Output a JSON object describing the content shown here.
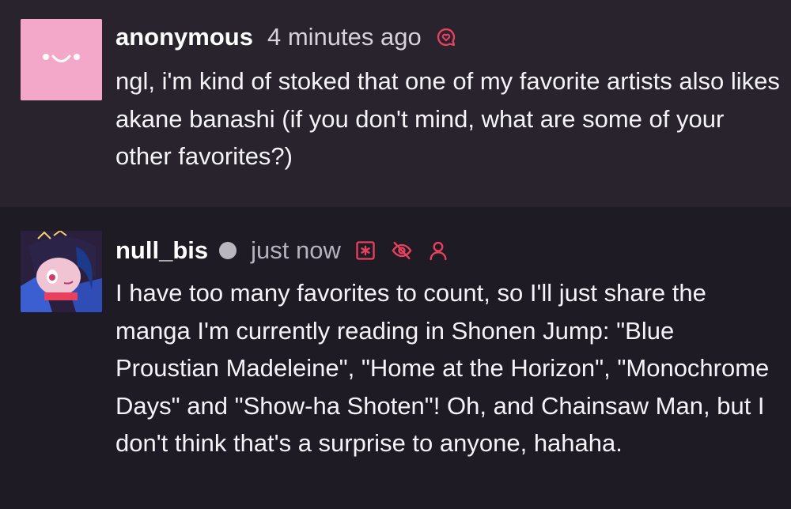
{
  "question": {
    "author": "anonymous",
    "timestamp": "4 minutes ago",
    "icon": "heart-chat-icon",
    "text": "ngl, i'm kind of stoked that one of my favorite artists also likes akane banashi (if you don't mind, what are some of your other favorites?)"
  },
  "answer": {
    "author": "null_bis",
    "timestamp": "just now",
    "icons": [
      "asterisk-box-icon",
      "eye-off-icon",
      "person-icon"
    ],
    "text": "I have too many favorites to count, so I'll just share the manga I'm currently reading in Shonen Jump: \"Blue Proustian Madeleine\", \"Home at the Horizon\", \"Monochrome Days\" and \"Show-ha Shoten\"! Oh, and Chainsaw Man, but I don't think that's a surprise to anyone, hahaha."
  },
  "colors": {
    "accent": "#e8415e",
    "question_bg": "#28232d",
    "answer_bg": "#1e1b24",
    "anon_avatar": "#f4a8c9",
    "status_dot": "#b9b6bd"
  }
}
